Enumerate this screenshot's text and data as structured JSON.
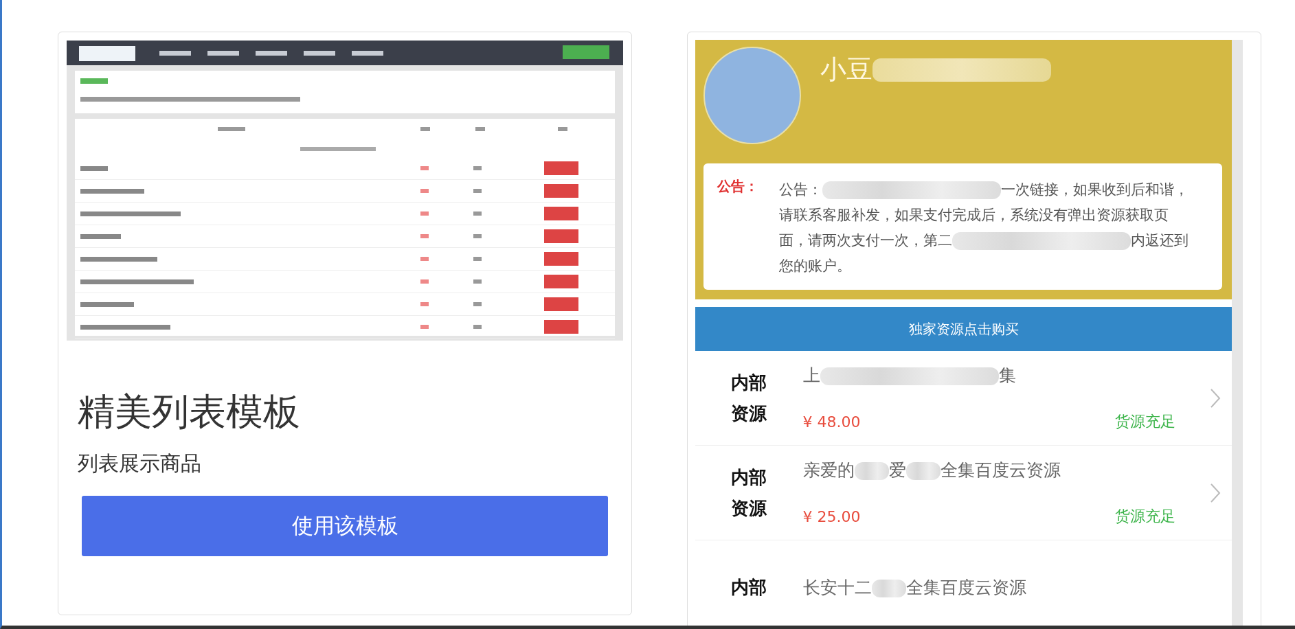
{
  "template_card": {
    "title": "精美列表模板",
    "subtitle": "列表展示商品",
    "button": "使用该模板"
  },
  "preview": {
    "user_name": [
      {
        "kind": "text",
        "text": "小豆"
      },
      {
        "kind": "redacted",
        "long": true
      }
    ],
    "notice": {
      "label": "公告：",
      "segments": [
        {
          "kind": "text",
          "text": "公告："
        },
        {
          "kind": "redacted",
          "long": true
        },
        {
          "kind": "text",
          "text": "一次链接，如果收到后和谐，请联系客服补发，如果支付完成后，系统没有弹出资源获取页面，请两次支付一次，第二"
        },
        {
          "kind": "redacted",
          "long": true
        },
        {
          "kind": "text",
          "text": "内返还到您的账户。"
        }
      ]
    },
    "buy_bar": "独家资源点击购买",
    "items": [
      {
        "badge": "内部资源",
        "title": [
          {
            "kind": "text",
            "text": "上"
          },
          {
            "kind": "redacted",
            "long": true
          },
          {
            "kind": "text",
            "text": "集"
          }
        ],
        "price": "¥ 48.00",
        "stock": "货源充足"
      },
      {
        "badge": "内部资源",
        "title": [
          {
            "kind": "text",
            "text": "亲爱的"
          },
          {
            "kind": "redacted",
            "long": false
          },
          {
            "kind": "text",
            "text": "爱"
          },
          {
            "kind": "redacted",
            "long": false
          },
          {
            "kind": "text",
            "text": "全集百度云资源"
          }
        ],
        "price": "¥ 25.00",
        "stock": "货源充足"
      },
      {
        "badge": "内部",
        "title": [
          {
            "kind": "text",
            "text": "长安十二"
          },
          {
            "kind": "redacted",
            "long": false
          },
          {
            "kind": "text",
            "text": "全集百度云资源"
          }
        ]
      }
    ]
  }
}
